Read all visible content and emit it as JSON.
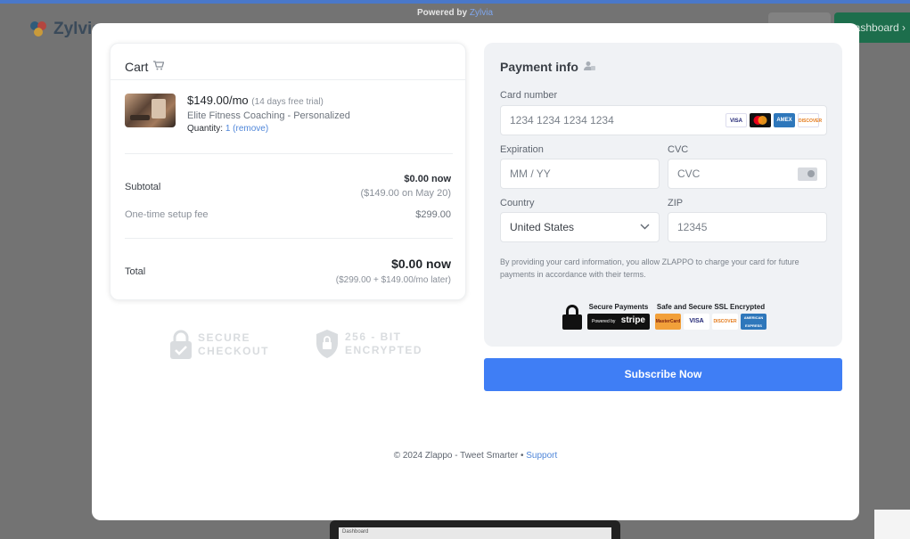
{
  "background": {
    "logo_text": "Zylvia",
    "dashboard_label": "Dashboard",
    "bottom_card_text": "Dashboard"
  },
  "powered_by": {
    "prefix": "Powered by",
    "brand": "Zylvia"
  },
  "cart": {
    "title": "Cart",
    "item": {
      "price": "$149.00/mo",
      "trial_note": "(14 days free trial)",
      "name": "Elite Fitness Coaching - Personalized",
      "quantity_label": "Quantity:",
      "quantity_value": "1",
      "remove_label": "(remove)"
    },
    "subtotal": {
      "label": "Subtotal",
      "now": "$0.00 now",
      "later": "($149.00 on May 20)"
    },
    "setup_fee": {
      "label": "One-time setup fee",
      "value": "$299.00"
    },
    "total": {
      "label": "Total",
      "now": "$0.00 now",
      "later": "($299.00 + $149.00/mo later)"
    }
  },
  "badges": {
    "secure_line1": "SECURE",
    "secure_line2": "CHECKOUT",
    "encrypt_line1": "256 - BIT",
    "encrypt_line2": "ENCRYPTED"
  },
  "payment": {
    "title": "Payment info",
    "card_number_label": "Card number",
    "card_number_placeholder": "1234 1234 1234 1234",
    "card_brands": [
      "VISA",
      "MC",
      "AMEX",
      "DISCOVER"
    ],
    "expiration_label": "Expiration",
    "expiration_placeholder": "MM / YY",
    "cvc_label": "CVC",
    "cvc_placeholder": "CVC",
    "country_label": "Country",
    "country_value": "United States",
    "zip_label": "ZIP",
    "zip_placeholder": "12345",
    "legal": "By providing your card information, you allow ZLAPPO to charge your card for future payments in accordance with their terms.",
    "secure_payments": "Secure Payments",
    "powered_by_small": "Powered by",
    "stripe": "stripe",
    "ssl_text": "Safe and Secure SSL Encrypted",
    "ssl_cards": [
      "MasterCard",
      "VISA",
      "DISCOVER",
      "AMERICAN EXPRESS"
    ]
  },
  "subscribe_label": "Subscribe Now",
  "footer": {
    "text": "© 2024 Zlappo - Tweet Smarter •",
    "support": "Support"
  },
  "colors": {
    "primary": "#3f7ef5",
    "link": "#4f86d9",
    "payment_bg": "#f0f2f5",
    "backdrop": "#737373"
  }
}
